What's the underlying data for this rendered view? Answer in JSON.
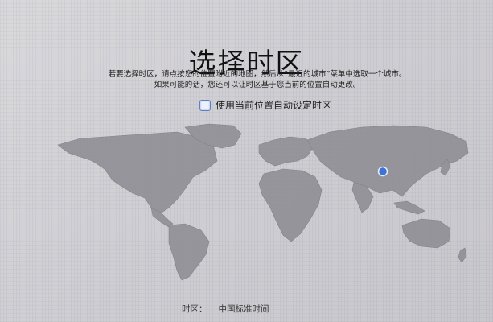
{
  "window": {
    "title": "选择时区",
    "instruction_line1": "若要选择时区，请点按您的位置附近的地图，然后从“最近的城市”菜单中选取一个城市。",
    "instruction_line2": "如果可能的话，您还可以让时区基于您当前的位置自动更改。"
  },
  "auto_timezone": {
    "label": "使用当前位置自动设定时区",
    "checked": false
  },
  "map": {
    "land_color": "#8f8f95",
    "selected_pin_color": "#3b73d9",
    "selected_region": "china"
  },
  "timezone": {
    "label": "时区：",
    "value": "中国标准时间"
  },
  "icons": [
    "checkbox-icon",
    "location-pin-icon"
  ]
}
